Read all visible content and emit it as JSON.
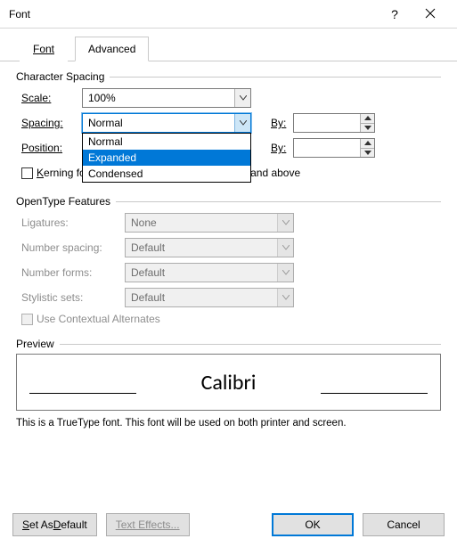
{
  "title": "Font",
  "tabs": {
    "font": "Font",
    "advanced": "Advanced"
  },
  "charSpacing": {
    "title": "Character Spacing",
    "scaleLabel": "Scale:",
    "scaleValue": "100%",
    "spacingLabel": "Spacing:",
    "spacingValue": "Normal",
    "byLabel": "By:",
    "positionLabel": "Position:",
    "spacingOptions": [
      "Normal",
      "Expanded",
      "Condensed"
    ],
    "selectedOption": "Expanded",
    "kerningLabel": "Kerning for fonts:",
    "pointsLabel": "Points and above"
  },
  "opentype": {
    "title": "OpenType Features",
    "ligaturesLabel": "Ligatures:",
    "ligaturesValue": "None",
    "numSpacingLabel": "Number spacing:",
    "numSpacingValue": "Default",
    "numFormsLabel": "Number forms:",
    "numFormsValue": "Default",
    "stylisticLabel": "Stylistic sets:",
    "stylisticValue": "Default",
    "contextualLabel": "Use Contextual Alternates"
  },
  "preview": {
    "title": "Preview",
    "fontName": "Calibri",
    "info": "This is a TrueType font. This font will be used on both printer and screen."
  },
  "buttons": {
    "setDefault": "Set As Default",
    "textEffects": "Text Effects...",
    "ok": "OK",
    "cancel": "Cancel"
  }
}
